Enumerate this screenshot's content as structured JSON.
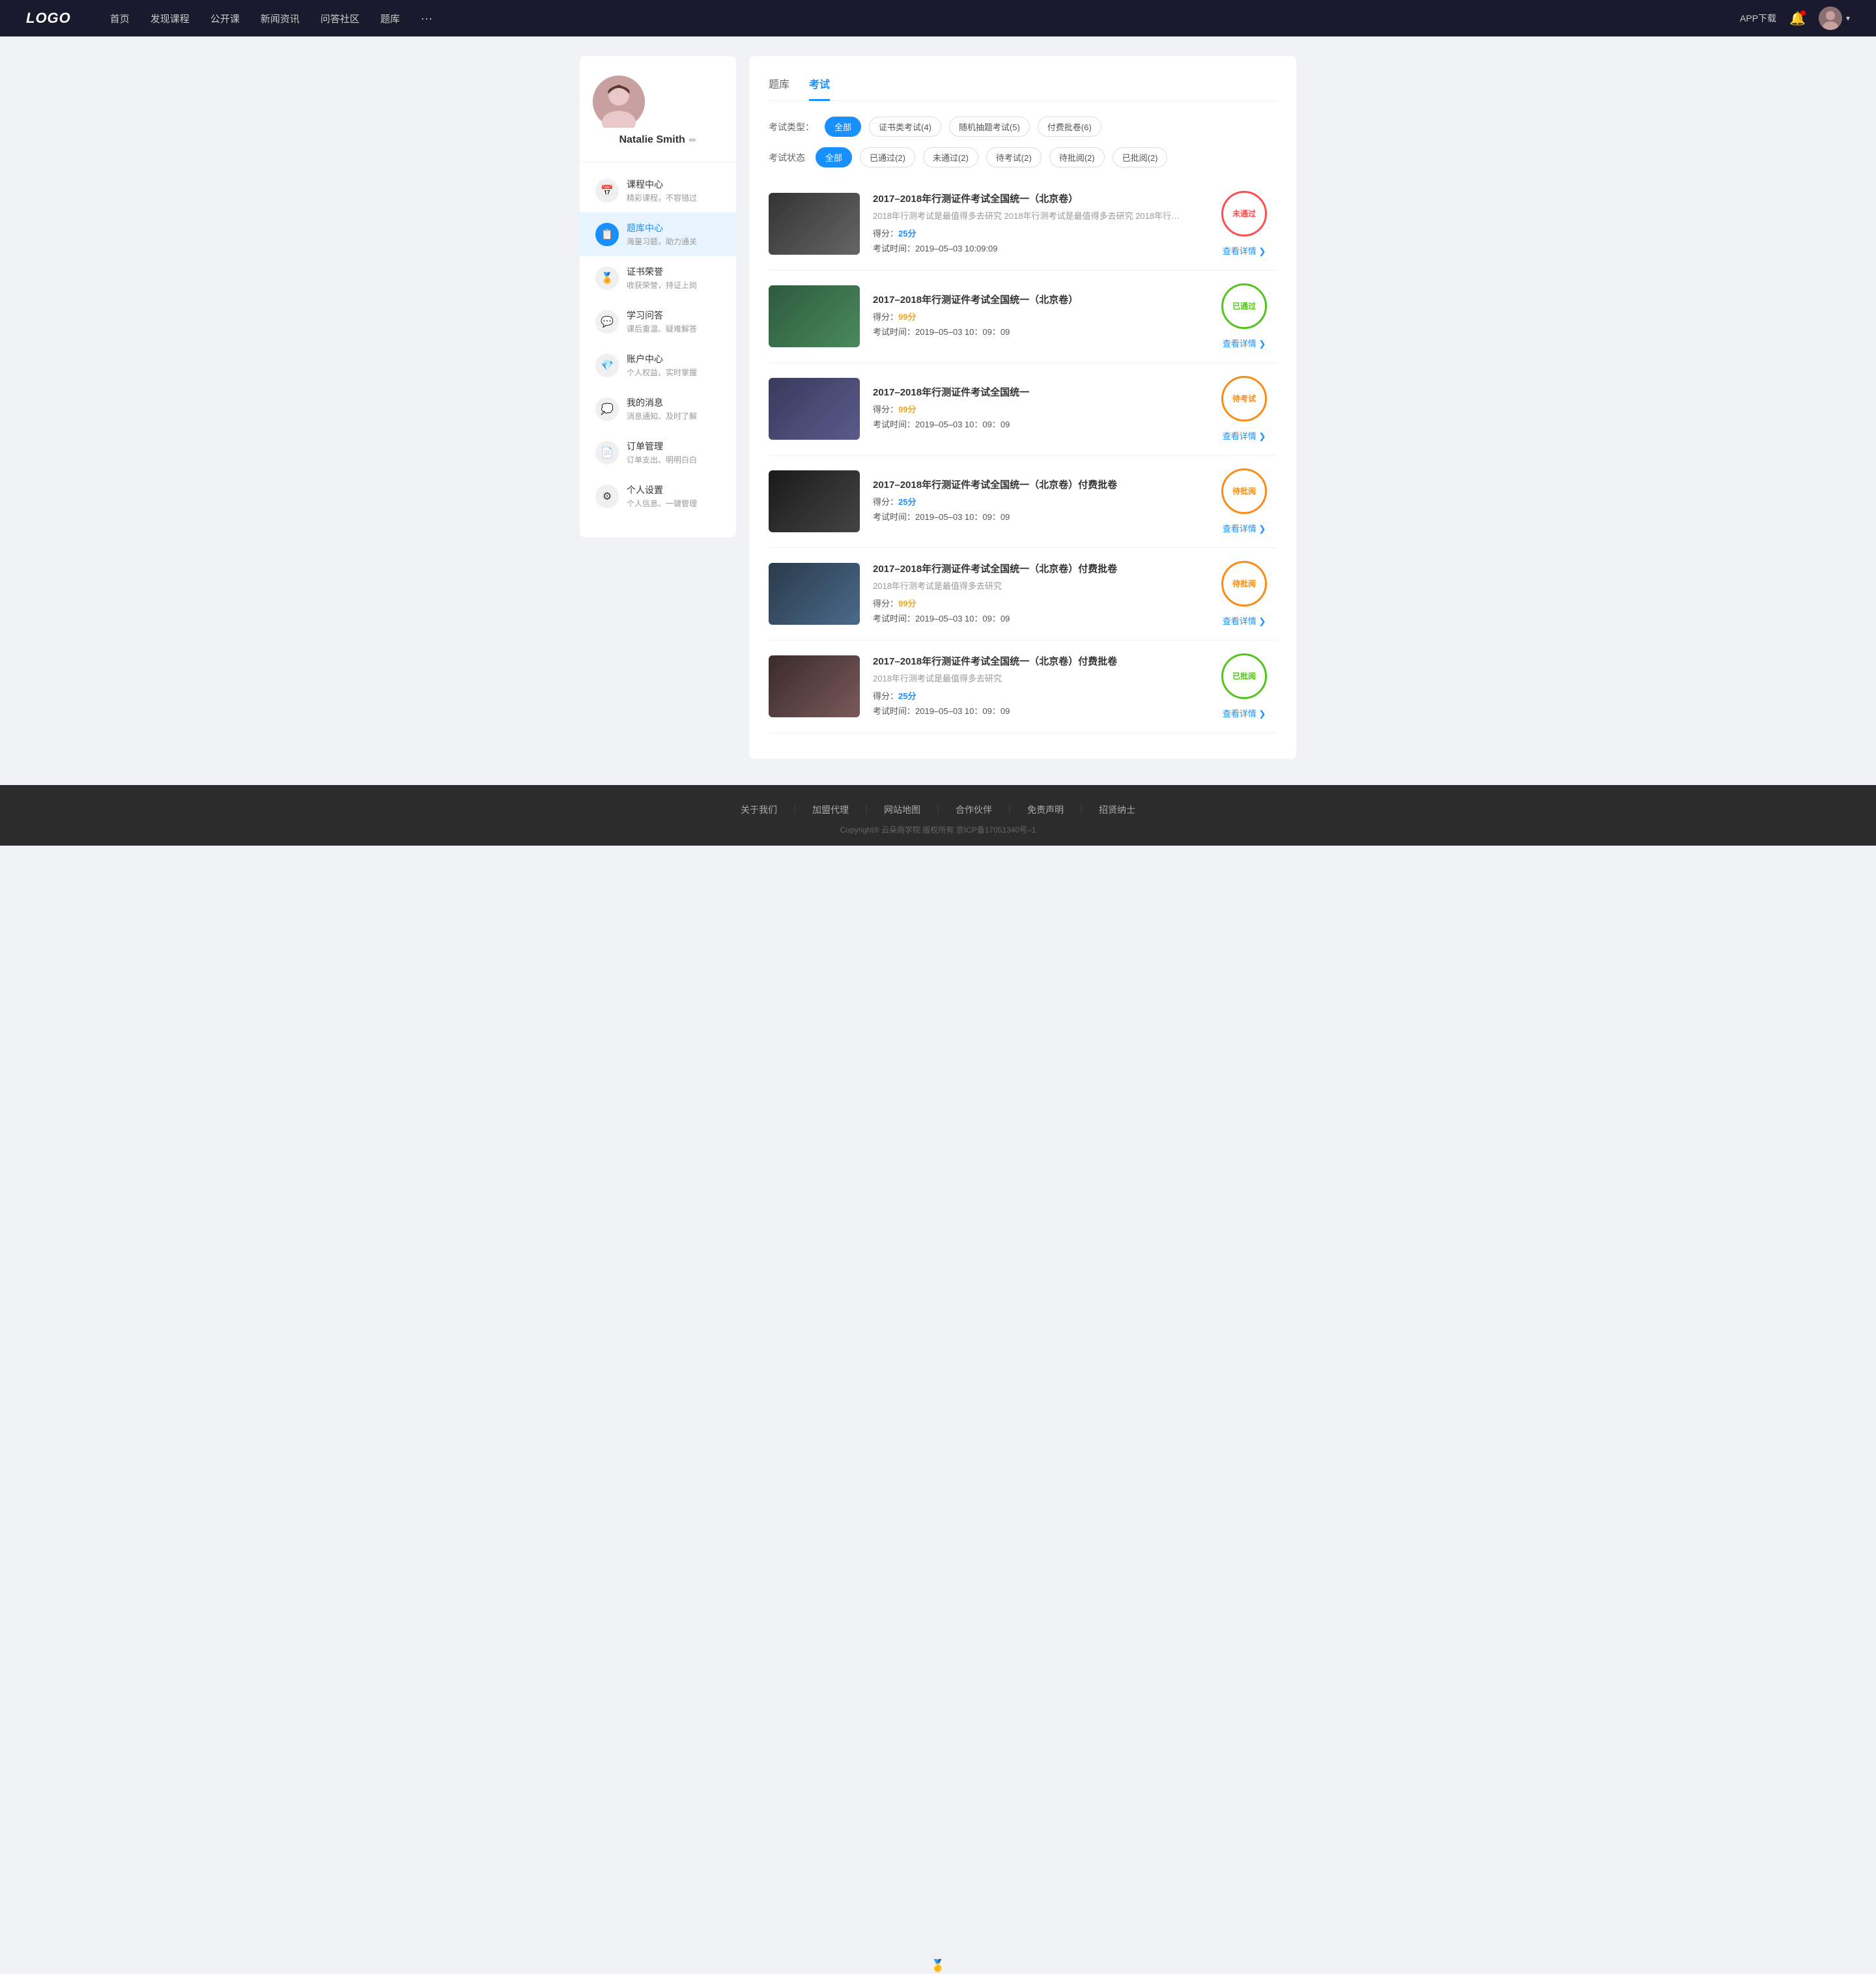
{
  "header": {
    "logo": "LOGO",
    "nav": [
      {
        "label": "首页"
      },
      {
        "label": "发现课程"
      },
      {
        "label": "公开课"
      },
      {
        "label": "新闻资讯"
      },
      {
        "label": "问答社区"
      },
      {
        "label": "题库"
      },
      {
        "label": "···"
      }
    ],
    "app_download": "APP下载",
    "bell": "🔔"
  },
  "sidebar": {
    "user_name": "Natalie Smith",
    "edit_icon": "✏",
    "menu": [
      {
        "id": "course",
        "icon": "📅",
        "title": "课程中心",
        "sub": "精彩课程，不容错过",
        "active": false
      },
      {
        "id": "question",
        "icon": "📋",
        "title": "题库中心",
        "sub": "海量习题，助力通关",
        "active": true
      },
      {
        "id": "honor",
        "icon": "🏅",
        "title": "证书荣誉",
        "sub": "收获荣誉，持证上岗",
        "active": false
      },
      {
        "id": "qa",
        "icon": "💬",
        "title": "学习问答",
        "sub": "课后重温、疑难解答",
        "active": false
      },
      {
        "id": "account",
        "icon": "💎",
        "title": "账户中心",
        "sub": "个人权益、实时掌握",
        "active": false
      },
      {
        "id": "message",
        "icon": "💭",
        "title": "我的消息",
        "sub": "消息通知、及时了解",
        "active": false
      },
      {
        "id": "order",
        "icon": "📄",
        "title": "订单管理",
        "sub": "订单支出、明明白白",
        "active": false
      },
      {
        "id": "settings",
        "icon": "⚙",
        "title": "个人设置",
        "sub": "个人信息、一键管理",
        "active": false
      }
    ]
  },
  "main": {
    "tabs": [
      {
        "label": "题库",
        "active": false
      },
      {
        "label": "考试",
        "active": true
      }
    ],
    "exam_type_label": "考试类型：",
    "exam_type_filters": [
      {
        "label": "全部",
        "active": true
      },
      {
        "label": "证书类考试(4)",
        "active": false
      },
      {
        "label": "随机抽题考试(5)",
        "active": false
      },
      {
        "label": "付费批卷(6)",
        "active": false
      }
    ],
    "exam_status_label": "考试状态",
    "exam_status_filters": [
      {
        "label": "全部",
        "active": true
      },
      {
        "label": "已通过(2)",
        "active": false
      },
      {
        "label": "未通过(2)",
        "active": false
      },
      {
        "label": "待考试(2)",
        "active": false
      },
      {
        "label": "待批阅(2)",
        "active": false
      },
      {
        "label": "已批阅(2)",
        "active": false
      }
    ],
    "exams": [
      {
        "id": 1,
        "title": "2017–2018年行测证件考试全国统一（北京卷）",
        "desc": "2018年行测考试是最值得多去研究 2018年行测考试是最值得多去研究 2018年行…",
        "score_label": "得分：",
        "score": "25",
        "score_color": "blue",
        "time_label": "考试时间：",
        "time": "2019–05–03  10:09:09",
        "stamp_text": "未通过",
        "stamp_type": "fail",
        "detail_label": "查看详情",
        "thumb_class": "thumb-1"
      },
      {
        "id": 2,
        "title": "2017–2018年行测证件考试全国统一（北京卷）",
        "desc": "",
        "score_label": "得分：",
        "score": "99",
        "score_color": "orange",
        "time_label": "考试时间：",
        "time": "2019–05–03  10：09：09",
        "stamp_text": "已通过",
        "stamp_type": "pass",
        "detail_label": "查看详情",
        "thumb_class": "thumb-2"
      },
      {
        "id": 3,
        "title": "2017–2018年行测证件考试全国统一",
        "desc": "",
        "score_label": "得分：",
        "score": "99",
        "score_color": "orange",
        "time_label": "考试时间：",
        "time": "2019–05–03  10：09：09",
        "stamp_text": "待考试",
        "stamp_type": "pending",
        "detail_label": "查看详情",
        "thumb_class": "thumb-3"
      },
      {
        "id": 4,
        "title": "2017–2018年行测证件考试全国统一（北京卷）付费批卷",
        "desc": "",
        "score_label": "得分：",
        "score": "25",
        "score_color": "blue",
        "time_label": "考试时间：",
        "time": "2019–05–03  10：09：09",
        "stamp_text": "待批阅",
        "stamp_type": "pending",
        "detail_label": "查看详情",
        "thumb_class": "thumb-4"
      },
      {
        "id": 5,
        "title": "2017–2018年行测证件考试全国统一（北京卷）付费批卷",
        "desc": "2018年行测考试是最值得多去研究",
        "score_label": "得分：",
        "score": "99",
        "score_color": "orange",
        "time_label": "考试时间：",
        "time": "2019–05–03  10：09：09",
        "stamp_text": "待批阅",
        "stamp_type": "pending",
        "detail_label": "查看详情",
        "thumb_class": "thumb-5"
      },
      {
        "id": 6,
        "title": "2017–2018年行测证件考试全国统一（北京卷）付费批卷",
        "desc": "2018年行测考试是最值得多去研究",
        "score_label": "得分：",
        "score": "25",
        "score_color": "blue",
        "time_label": "考试时间：",
        "time": "2019–05–03  10：09：09",
        "stamp_text": "已批阅",
        "stamp_type": "reviewed",
        "detail_label": "查看详情",
        "thumb_class": "thumb-6"
      }
    ]
  },
  "footer": {
    "links": [
      "关于我们",
      "加盟代理",
      "网站地图",
      "合作伙伴",
      "免责声明",
      "招贤纳士"
    ],
    "copyright": "Copyright® 云朵商学院  版权所有    京ICP备17051340号–1"
  }
}
